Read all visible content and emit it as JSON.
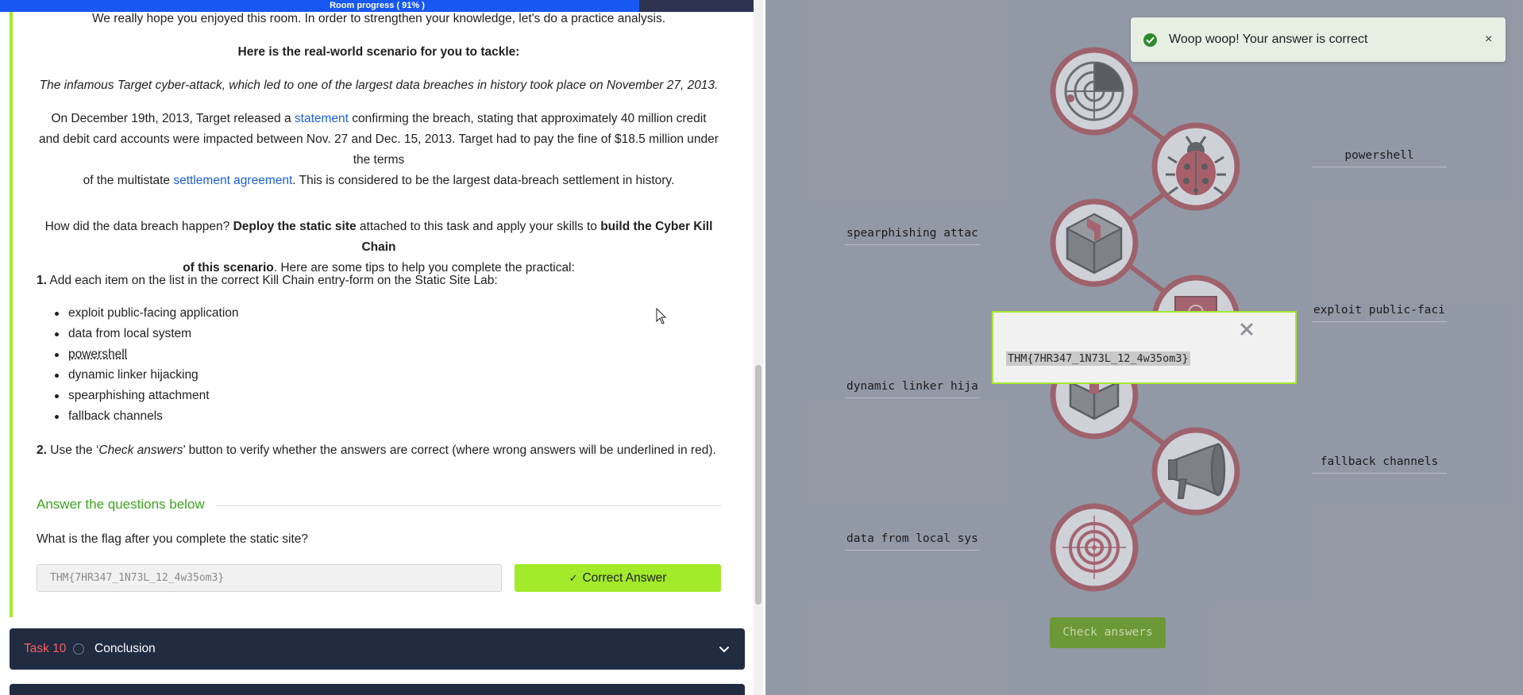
{
  "progress": {
    "label": "Room progress ( 91% )",
    "percent": 91
  },
  "task": {
    "intro": "We really hope you enjoyed this room. In order to strengthen your knowledge, let's do a practice analysis.",
    "scenario_heading": "Here is the real-world scenario for you to tackle:",
    "scenario_italic": "The infamous Target cyber-attack, which led to one of the largest data breaches in history took place on November 27, 2013.",
    "para1": {
      "a": "On December 19th, 2013, Target released a ",
      "link1": "statement",
      "b": " confirming the breach, stating that approximately 40 million credit",
      "c": "and debit card accounts were impacted between Nov. 27 and Dec. 15, 2013. Target had to pay the fine of $18.5 million under the terms",
      "d": "of the multistate ",
      "link2": "settlement agreement",
      "e": ". This is considered to be the largest data-breach settlement in history."
    },
    "para2": {
      "a": "How did the data breach happen? ",
      "b": "Deploy the static site",
      "c": " attached to this task and apply your skills to ",
      "d": "build the Cyber Kill Chain",
      "e": "of this scenario",
      "f": ". Here are some tips to help you complete the practical:"
    },
    "step1": {
      "num": "1.",
      "text": " Add each item on the list in the correct Kill Chain entry-form on the Static Site Lab:"
    },
    "items": [
      "exploit public-facing application",
      "data from local system",
      "powershell",
      "dynamic linker hijacking",
      "spearphishing attachment",
      "fallback channels"
    ],
    "step2": {
      "num": "2.",
      "a": " Use the ‘",
      "b": "Check answers",
      "c": "’ button to verify whether the answers are correct (where wrong answers will be underlined in red)."
    }
  },
  "answers": {
    "heading": "Answer the questions below",
    "question": "What is the flag after you complete the static site?",
    "input_value": "THM{7HR347_1N73L_12_4w35om3}",
    "button_label": "Correct Answer"
  },
  "task10": {
    "number": "Task 10",
    "title": "Conclusion"
  },
  "lab": {
    "fields": {
      "powershell": "powershell",
      "spearphishing": "spearphishing attac",
      "exploit": "exploit public-faci",
      "dynamic": "dynamic linker hija",
      "fallback": "fallback channels",
      "data_local": "data from local sys"
    },
    "check_button": "Check answers",
    "toast": "Woop woop! Your answer is correct",
    "toast_close": "×",
    "flag": "THM{7HR347_1N73L_12_4w35om3}"
  },
  "colors": {
    "accent_green": "#a3ea2a",
    "ring_red": "#a8363e",
    "progress_blue": "#1858f0",
    "panel_dark": "#212c42",
    "lab_bg": "#939aa6"
  },
  "icons": [
    "radar-icon",
    "ladybug-icon",
    "package-icon",
    "document-icon",
    "open-box-icon",
    "megaphone-icon",
    "target-icon",
    "check-circle-icon",
    "close-icon",
    "chevron-down-icon",
    "circle-icon",
    "check-icon",
    "cursor-icon"
  ]
}
